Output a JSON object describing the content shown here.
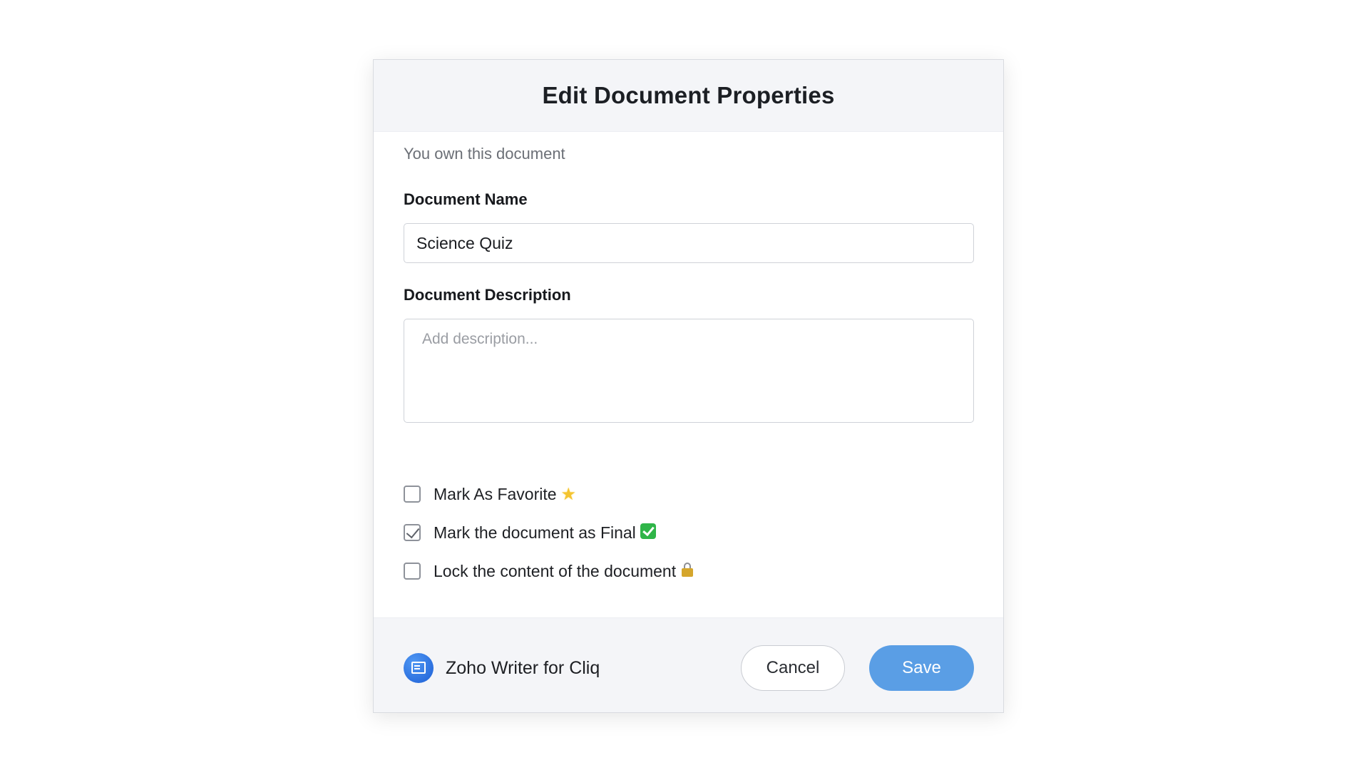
{
  "dialog": {
    "title": "Edit Document Properties",
    "owner_note": "You own this document"
  },
  "fields": {
    "name_label": "Document Name",
    "name_value": "Science Quiz",
    "description_label": "Document Description",
    "description_value": "",
    "description_placeholder": "Add description..."
  },
  "options": [
    {
      "label": "Mark As Favorite",
      "checked": false,
      "emoji": "star-icon"
    },
    {
      "label": "Mark the document as Final",
      "checked": true,
      "emoji": "check-mark-button-icon"
    },
    {
      "label": "Lock the content of the document",
      "checked": false,
      "emoji": "lock-icon"
    }
  ],
  "footer": {
    "brand_name": "Zoho Writer for Cliq",
    "brand_icon": "zoho-writer-logo-icon",
    "cancel_label": "Cancel",
    "save_label": "Save"
  },
  "colors": {
    "save_button": "#5a9ee5",
    "header_bg": "#f4f5f8",
    "final_check_emoji": "#2fb548"
  }
}
